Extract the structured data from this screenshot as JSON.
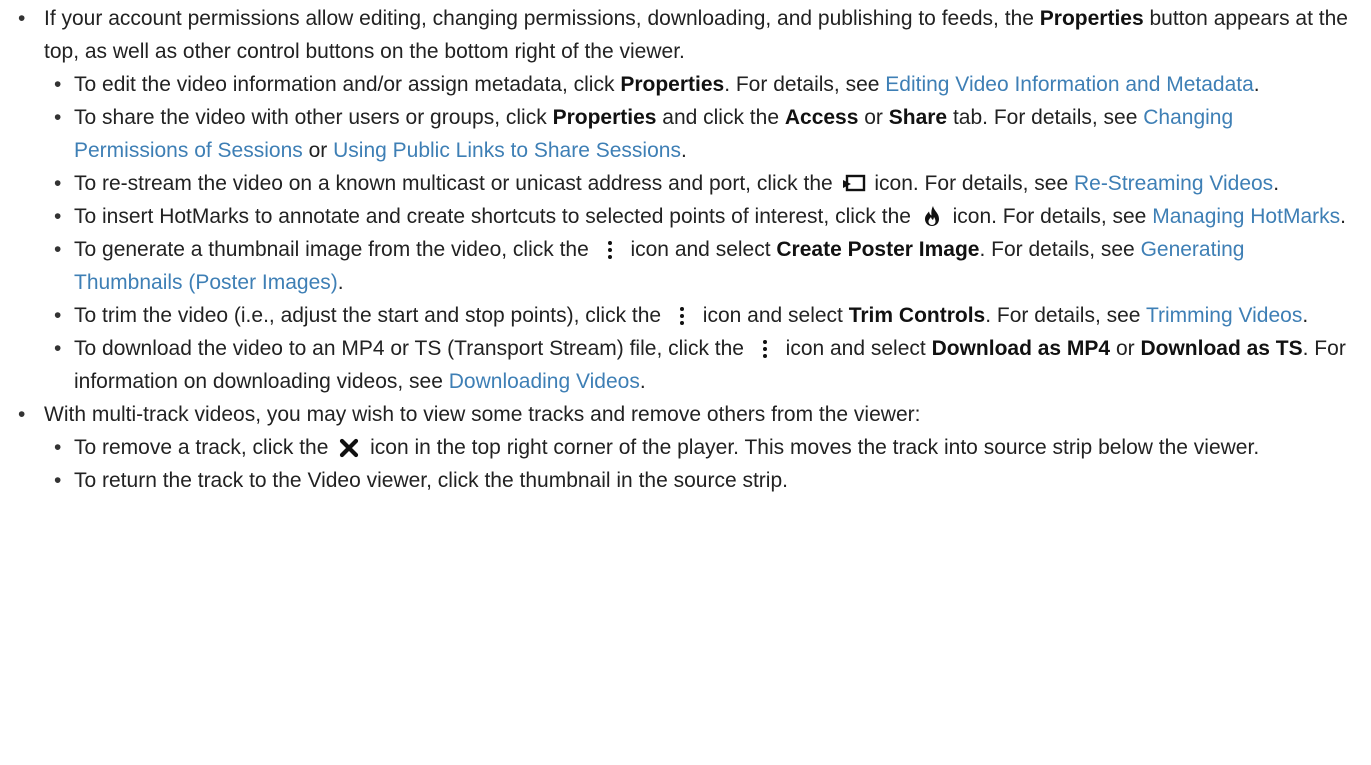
{
  "colors": {
    "text": "#222222",
    "link": "#3e7fb5",
    "icon": "#111111"
  },
  "icons": {
    "restream": "restream-icon",
    "hotmarks": "hotmark-flame-icon",
    "more": "more-vertical-icon",
    "remove": "close-x-icon"
  },
  "b1": {
    "t1": "If your account permissions allow editing, changing permissions, downloading, and publishing to feeds, the ",
    "b1": "Properties",
    "t2": " button appears at the top, as well as other control buttons on the bottom right of the viewer.",
    "items": [
      {
        "t1": "To edit the video information and/or assign metadata, click ",
        "b1": "Properties",
        "t2": ". For details, see ",
        "l1": "Editing Video Information and Metadata",
        "t3": "."
      },
      {
        "t1": "To share the video with other users or groups, click ",
        "b1": "Properties",
        "t2": " and click the ",
        "b2": "Access",
        "t3": " or ",
        "b3": "Share",
        "t4": " tab. For details, see ",
        "l1": "Changing Permissions of Sessions",
        "t5": " or ",
        "l2": "Using Public Links to Share Sessions",
        "t6": "."
      },
      {
        "t1": "To re-stream the video on a known multicast or unicast address and port, click the ",
        "t2": " icon. For details, see ",
        "l1": "Re-Streaming Videos",
        "t3": "."
      },
      {
        "t1": "To insert HotMarks to annotate and create shortcuts to selected points of interest, click the ",
        "t2": " icon. For details, see ",
        "l1": "Managing HotMarks",
        "t3": "."
      },
      {
        "t1": "To generate a thumbnail image from the video, click the ",
        "t2": " icon and select ",
        "b1": "Create Poster Image",
        "t3": ". For details, see ",
        "l1": "Generating Thumbnails (Poster Images)",
        "t4": "."
      },
      {
        "t1": "To trim the video (i.e., adjust the start and stop points), click the ",
        "t2": " icon and select ",
        "b1": "Trim Controls",
        "t3": ". For details, see ",
        "l1": "Trimming Videos",
        "t4": "."
      },
      {
        "t1": "To download the video to an MP4 or TS (Transport Stream) file, click the ",
        "t2": " icon and select ",
        "b1": "Download as MP4",
        "t3": " or ",
        "b2": "Download as TS",
        "t4": ". For information on downloading videos, see ",
        "l1": "Downloading Videos",
        "t5": "."
      }
    ]
  },
  "b2": {
    "t1": "With multi-track videos, you may wish to view some tracks and remove others from the viewer:",
    "items": [
      {
        "t1": "To remove a track, click the ",
        "t2": " icon in the top right corner of the player. This moves the track into source strip below the viewer."
      },
      {
        "t1": "To return the track to the Video viewer, click the thumbnail in the source strip."
      }
    ]
  }
}
